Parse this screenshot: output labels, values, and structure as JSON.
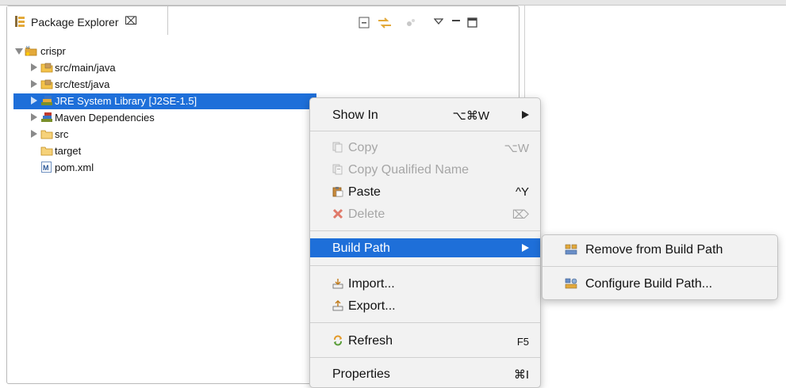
{
  "view": {
    "title": "Package Explorer",
    "close_glyph": "⌧"
  },
  "tree": {
    "items": [
      {
        "label": "crispr",
        "icon": "project-icon"
      },
      {
        "label": "src/main/java",
        "icon": "source-folder-icon"
      },
      {
        "label": "src/test/java",
        "icon": "source-folder-icon"
      },
      {
        "label": "JRE System Library [J2SE-1.5]",
        "icon": "library-icon"
      },
      {
        "label": "Maven Dependencies",
        "icon": "library-icon"
      },
      {
        "label": "src",
        "icon": "folder-icon"
      },
      {
        "label": "target",
        "icon": "folder-icon"
      },
      {
        "label": "pom.xml",
        "icon": "maven-file-icon"
      }
    ]
  },
  "context_menu": {
    "show_in": {
      "label": "Show In",
      "shortcut": "⌥⌘W"
    },
    "copy": {
      "label": "Copy",
      "shortcut": "⌥W"
    },
    "copy_qualified": {
      "label": "Copy Qualified Name"
    },
    "paste": {
      "label": "Paste",
      "shortcut": "^Y"
    },
    "delete": {
      "label": "Delete",
      "shortcut": "⌦"
    },
    "build_path": {
      "label": "Build Path"
    },
    "import": {
      "label": "Import..."
    },
    "export": {
      "label": "Export..."
    },
    "refresh": {
      "label": "Refresh",
      "shortcut": "F5"
    },
    "properties": {
      "label": "Properties",
      "shortcut": "⌘I"
    }
  },
  "submenu": {
    "remove": {
      "label": "Remove from Build Path"
    },
    "configure": {
      "label": "Configure Build Path..."
    }
  },
  "colors": {
    "selection": "#1e6fd9",
    "disabled_text": "#a6a6a6"
  }
}
